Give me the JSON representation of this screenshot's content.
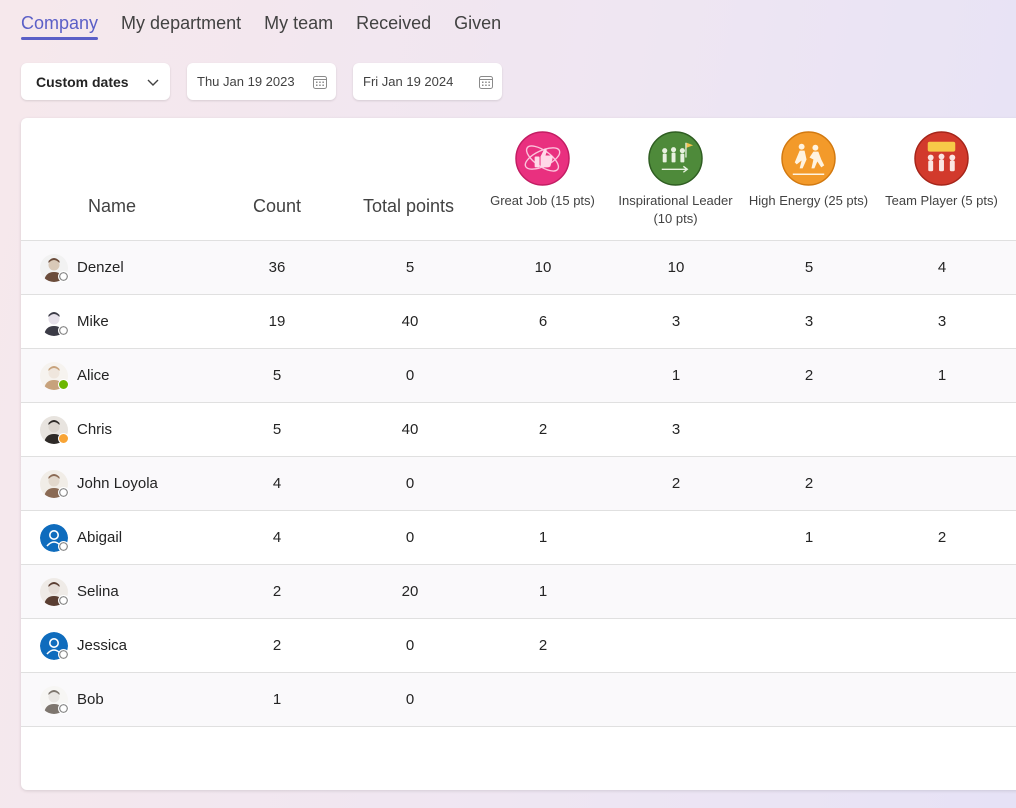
{
  "tabs": [
    {
      "label": "Company",
      "active": true
    },
    {
      "label": "My department",
      "active": false
    },
    {
      "label": "My team",
      "active": false
    },
    {
      "label": "Received",
      "active": false
    },
    {
      "label": "Given",
      "active": false
    }
  ],
  "filters": {
    "range_dropdown": "Custom dates",
    "start_date": "Thu Jan 19 2023",
    "end_date": "Fri Jan 19 2024"
  },
  "table": {
    "headers": {
      "name": "Name",
      "count": "Count",
      "total_points": "Total points"
    },
    "badges": [
      {
        "label": "Great Job (15 pts)",
        "color": "#e9307f",
        "icon": "thumbs-up-badge-icon"
      },
      {
        "label": "Inspirational Leader (10 pts)",
        "color": "#4e8a3a",
        "icon": "leader-badge-icon"
      },
      {
        "label": "High Energy (25 pts)",
        "color": "#f39a2a",
        "icon": "high-energy-badge-icon"
      },
      {
        "label": "Team Player (5 pts)",
        "color": "#d23a2c",
        "icon": "team-badge-icon"
      }
    ],
    "rows": [
      {
        "name": "Denzel",
        "count": "36",
        "total": "5",
        "b1": "10",
        "b2": "10",
        "b3": "5",
        "b4": "4",
        "status": "offline",
        "avatar": "photo"
      },
      {
        "name": "Mike",
        "count": "19",
        "total": "40",
        "b1": "6",
        "b2": "3",
        "b3": "3",
        "b4": "3",
        "status": "offline",
        "avatar": "photo"
      },
      {
        "name": "Alice",
        "count": "5",
        "total": "0",
        "b1": "",
        "b2": "1",
        "b3": "2",
        "b4": "1",
        "status": "online",
        "avatar": "photo"
      },
      {
        "name": "Chris",
        "count": "5",
        "total": "40",
        "b1": "2",
        "b2": "3",
        "b3": "",
        "b4": "",
        "status": "away",
        "avatar": "photo"
      },
      {
        "name": "John Loyola",
        "count": "4",
        "total": "0",
        "b1": "",
        "b2": "2",
        "b3": "2",
        "b4": "",
        "status": "offline",
        "avatar": "photo"
      },
      {
        "name": "Abigail",
        "count": "4",
        "total": "0",
        "b1": "1",
        "b2": "",
        "b3": "1",
        "b4": "2",
        "status": "offline",
        "avatar": "default"
      },
      {
        "name": "Selina",
        "count": "2",
        "total": "20",
        "b1": "1",
        "b2": "",
        "b3": "",
        "b4": "",
        "status": "offline",
        "avatar": "photo"
      },
      {
        "name": "Jessica",
        "count": "2",
        "total": "0",
        "b1": "2",
        "b2": "",
        "b3": "",
        "b4": "",
        "status": "offline",
        "avatar": "default"
      },
      {
        "name": "Bob",
        "count": "1",
        "total": "0",
        "b1": "",
        "b2": "",
        "b3": "",
        "b4": "",
        "status": "offline",
        "avatar": "photo"
      }
    ]
  },
  "colors": {
    "accent": "#5b5fc7",
    "default_avatar": "#0f6cbd"
  }
}
